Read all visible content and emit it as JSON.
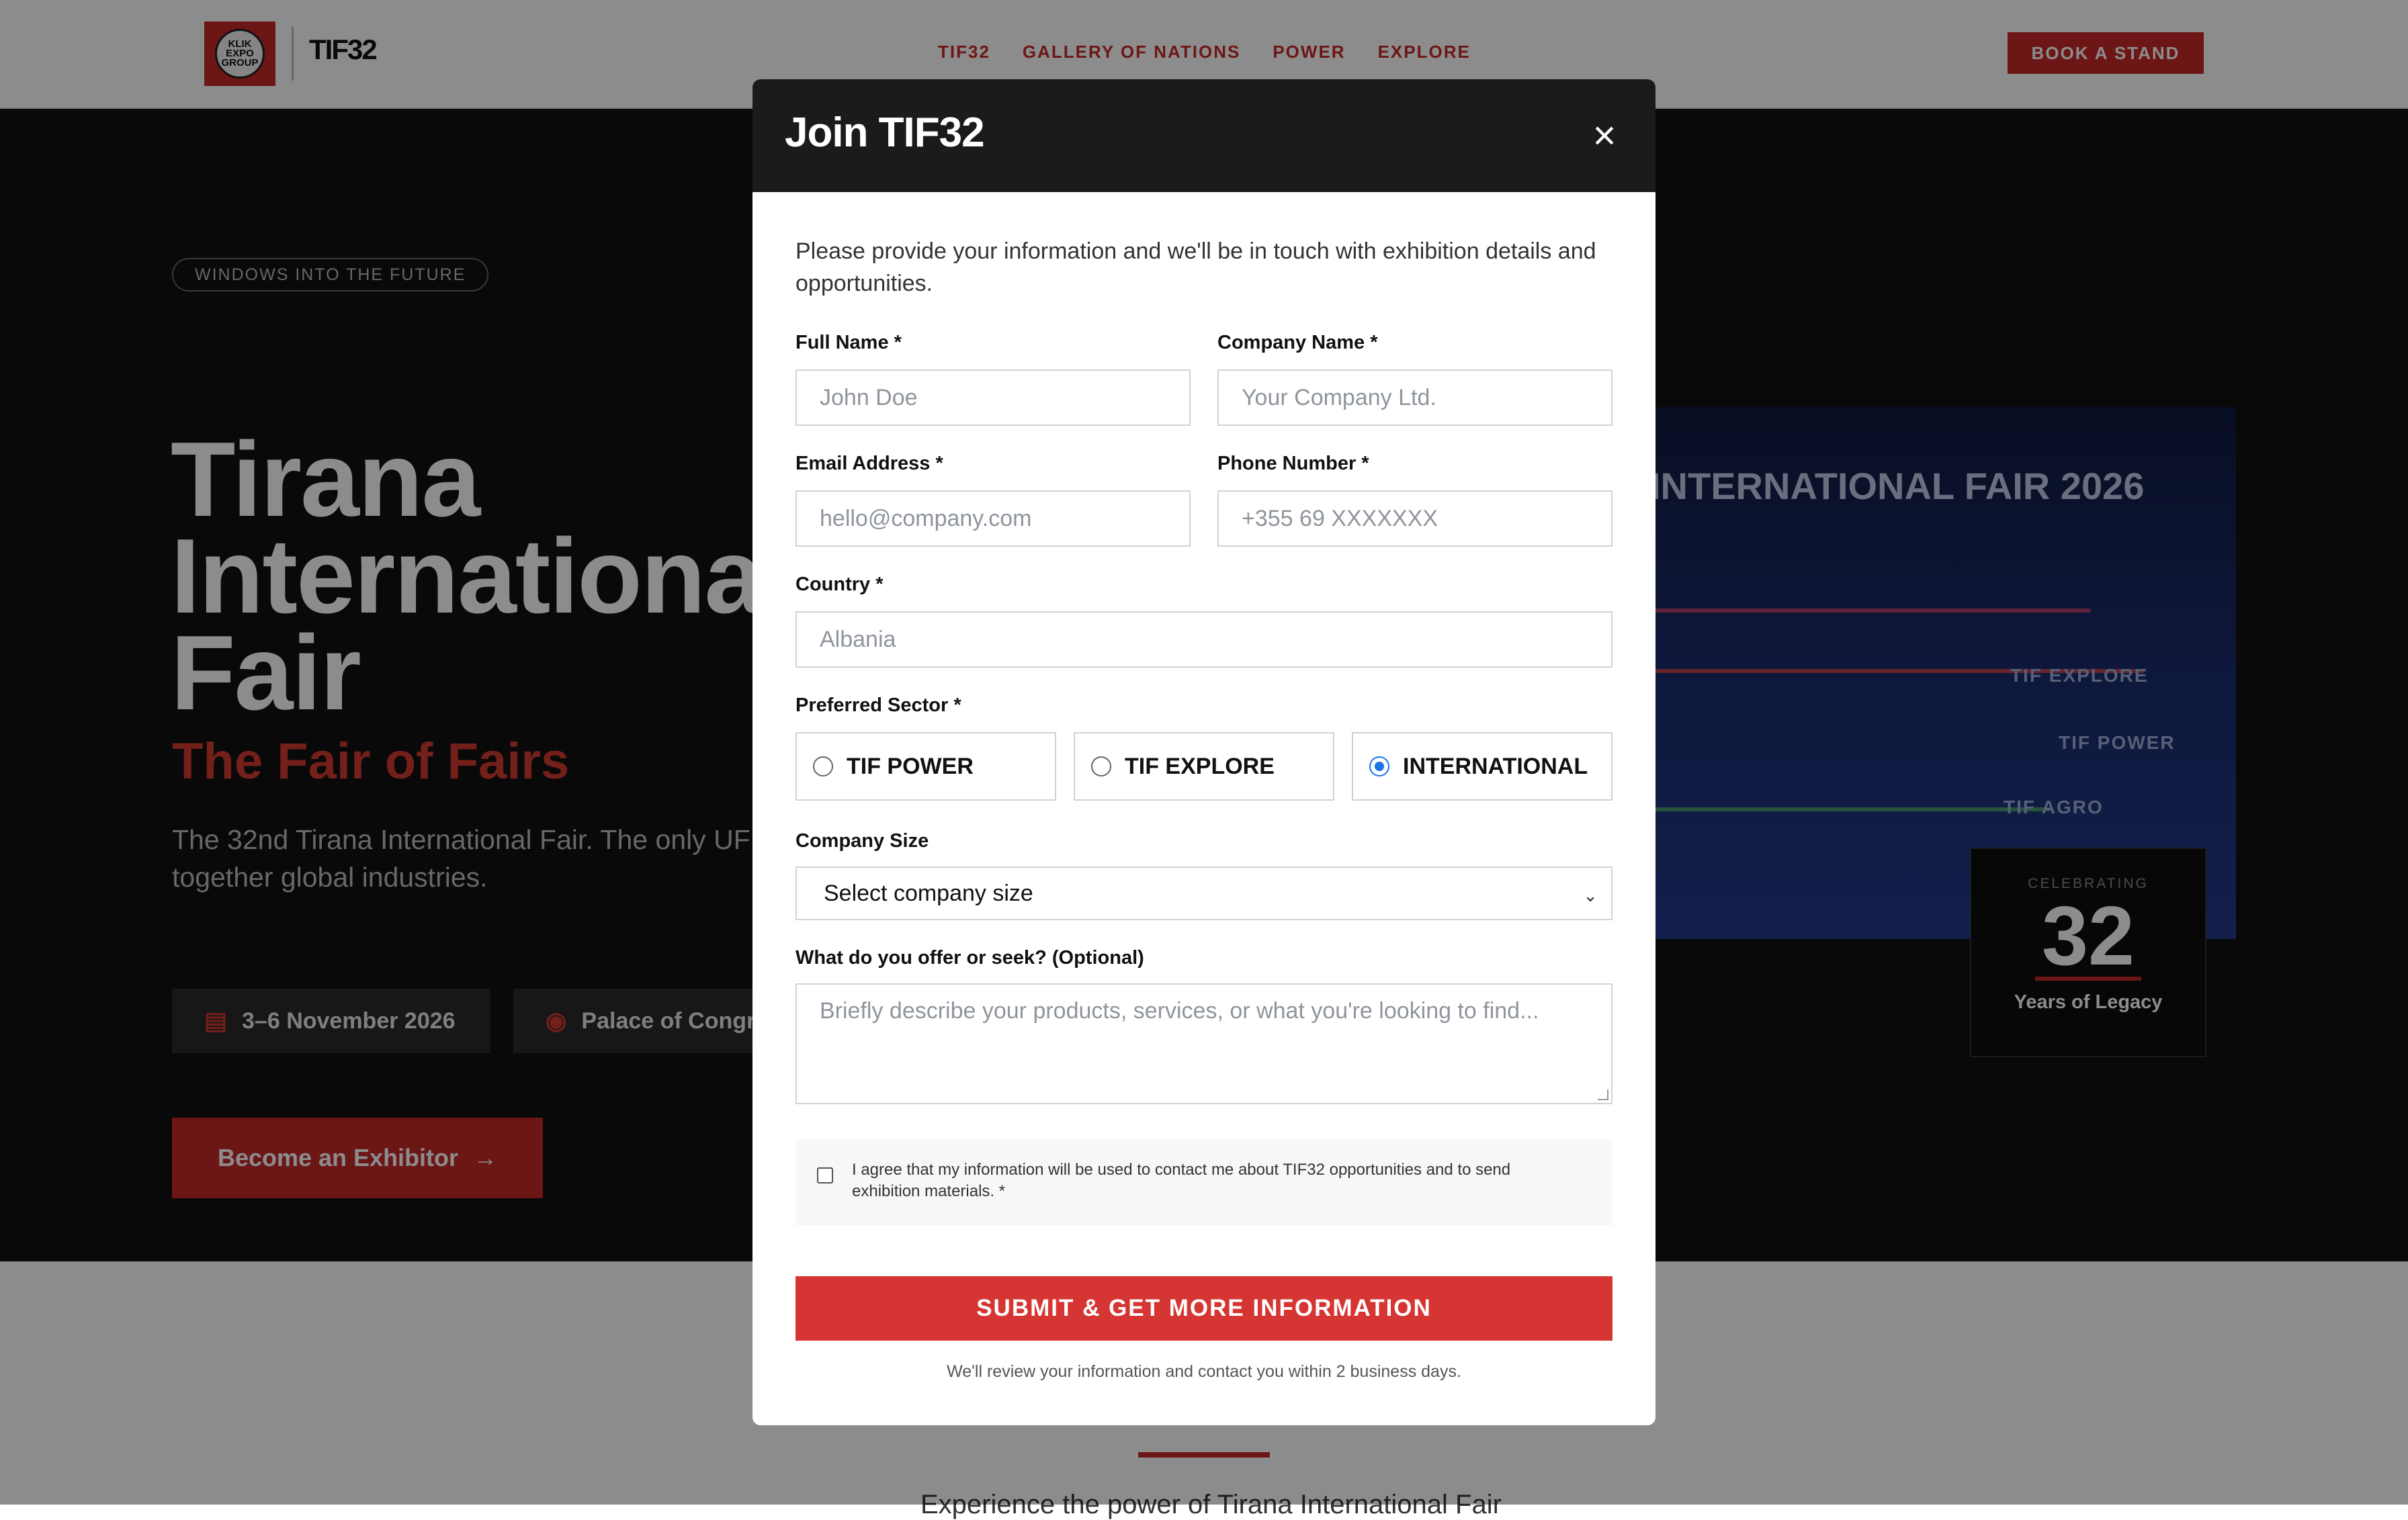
{
  "header": {
    "logo_text": "KLIK EXPO GROUP",
    "brand": "TIF32",
    "nav": [
      "TIF32",
      "GALLERY OF NATIONS",
      "POWER",
      "EXPLORE"
    ],
    "book_button": "BOOK A STAND"
  },
  "hero": {
    "tagline": "WINDOWS INTO THE FUTURE",
    "title_line1": "Tirana",
    "title_line2": "International",
    "title_line3": "Fair",
    "subtitle": "The Fair of Fairs",
    "description": "The 32nd Tirana International Fair. The only UFI approved event in Albania bringing together global industries.",
    "date": "3–6 November 2026",
    "location": "Palace of Congresses",
    "cta": "Become an Exhibitor",
    "image": {
      "title": "INTERNATIONAL FAIR 2026",
      "labels": [
        "TIF EXPLORE",
        "TIF POWER",
        "TIF AGRO"
      ]
    },
    "legacy": {
      "celebrating": "CELEBRATING",
      "number": "32",
      "years": "Years of Legacy"
    }
  },
  "below": {
    "text": "Experience the power of Tirana International Fair"
  },
  "modal": {
    "title": "Join TIF32",
    "close_icon": "close-icon",
    "intro": "Please provide your information and we'll be in touch with exhibition details and opportunities.",
    "fields": {
      "full_name": {
        "label": "Full Name *",
        "placeholder": "John Doe"
      },
      "company_name": {
        "label": "Company Name *",
        "placeholder": "Your Company Ltd."
      },
      "email": {
        "label": "Email Address *",
        "placeholder": "hello@company.com"
      },
      "phone": {
        "label": "Phone Number *",
        "placeholder": "+355 69 XXXXXXX"
      },
      "country": {
        "label": "Country *",
        "placeholder": "Albania"
      }
    },
    "sector": {
      "label": "Preferred Sector *",
      "options": [
        "TIF POWER",
        "TIF EXPLORE",
        "INTERNATIONAL"
      ],
      "selected": "INTERNATIONAL"
    },
    "company_size": {
      "label": "Company Size",
      "selected": "Select company size"
    },
    "offer": {
      "label": "What do you offer or seek? (Optional)",
      "placeholder": "Briefly describe your products, services, or what you're looking to find..."
    },
    "consent": "I agree that my information will be used to contact me about TIF32 opportunities and to send exhibition materials. *",
    "submit": "SUBMIT & GET MORE INFORMATION",
    "note": "We'll review your information and contact you within 2 business days."
  },
  "colors": {
    "brand_red": "#c62828",
    "submit_red": "#d63633",
    "modal_header": "#1c1b1b",
    "radio_blue": "#1a73e8"
  }
}
